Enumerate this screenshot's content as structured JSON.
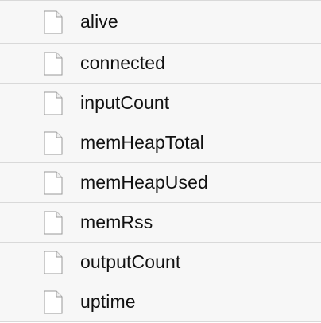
{
  "file_list": {
    "icon": "document-icon",
    "items": [
      {
        "label": "alive"
      },
      {
        "label": "connected"
      },
      {
        "label": "inputCount"
      },
      {
        "label": "memHeapTotal"
      },
      {
        "label": "memHeapUsed"
      },
      {
        "label": "memRss"
      },
      {
        "label": "outputCount"
      },
      {
        "label": "uptime"
      }
    ]
  }
}
